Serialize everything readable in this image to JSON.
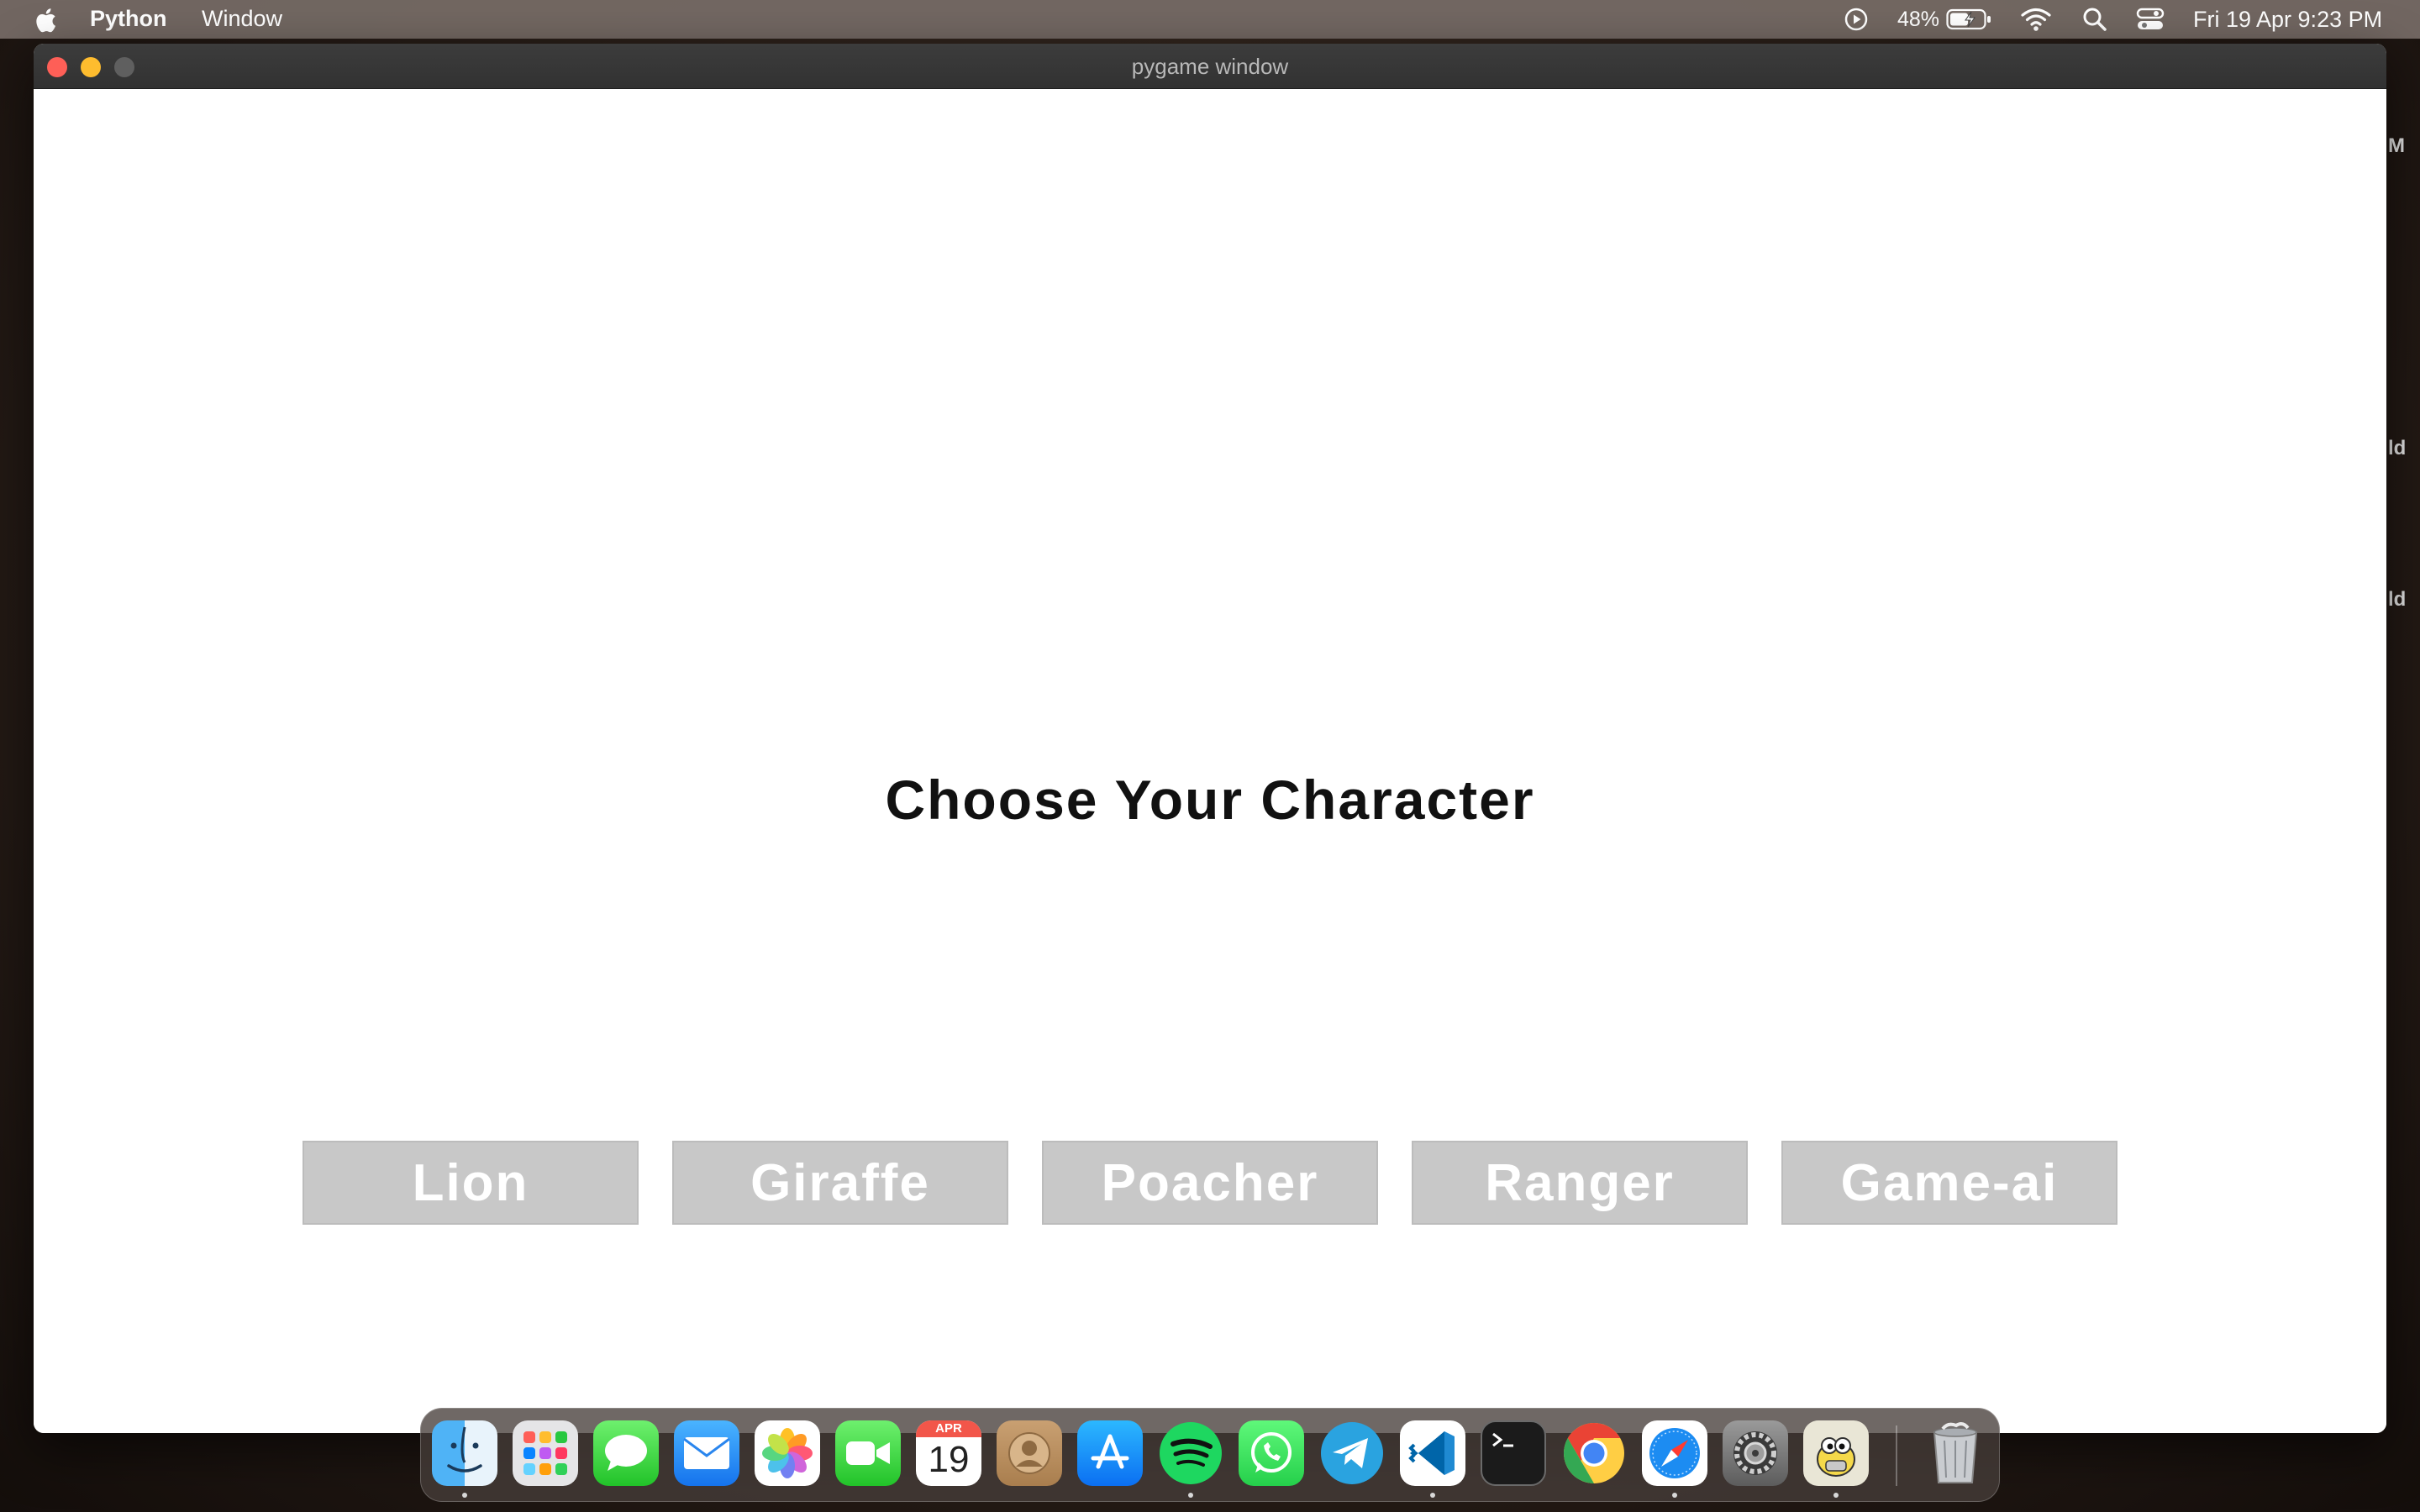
{
  "menubar": {
    "app_name": "Python",
    "menu_window": "Window",
    "battery_percent": "48%",
    "datetime": "Fri 19 Apr  9:23 PM"
  },
  "window": {
    "title": "pygame window"
  },
  "game": {
    "heading": "Choose Your Character",
    "characters": [
      "Lion",
      "Giraffe",
      "Poacher",
      "Ranger",
      "Game-ai"
    ]
  },
  "edge_fragments": [
    "M",
    "ld",
    "ld"
  ],
  "dock": {
    "calendar_month": "APR",
    "calendar_day": "19",
    "apps": [
      "finder",
      "launchpad",
      "messages",
      "mail",
      "photos",
      "facetime",
      "calendar",
      "contacts",
      "app-store",
      "spotify",
      "whatsapp",
      "telegram",
      "vscode",
      "terminal",
      "chrome",
      "safari",
      "system-settings",
      "python-launcher",
      "trash"
    ]
  },
  "colors": {
    "button_bg": "#c8c8c8",
    "button_text": "#ffffff",
    "heading_text": "#111111",
    "game_bg": "#ffffff"
  }
}
